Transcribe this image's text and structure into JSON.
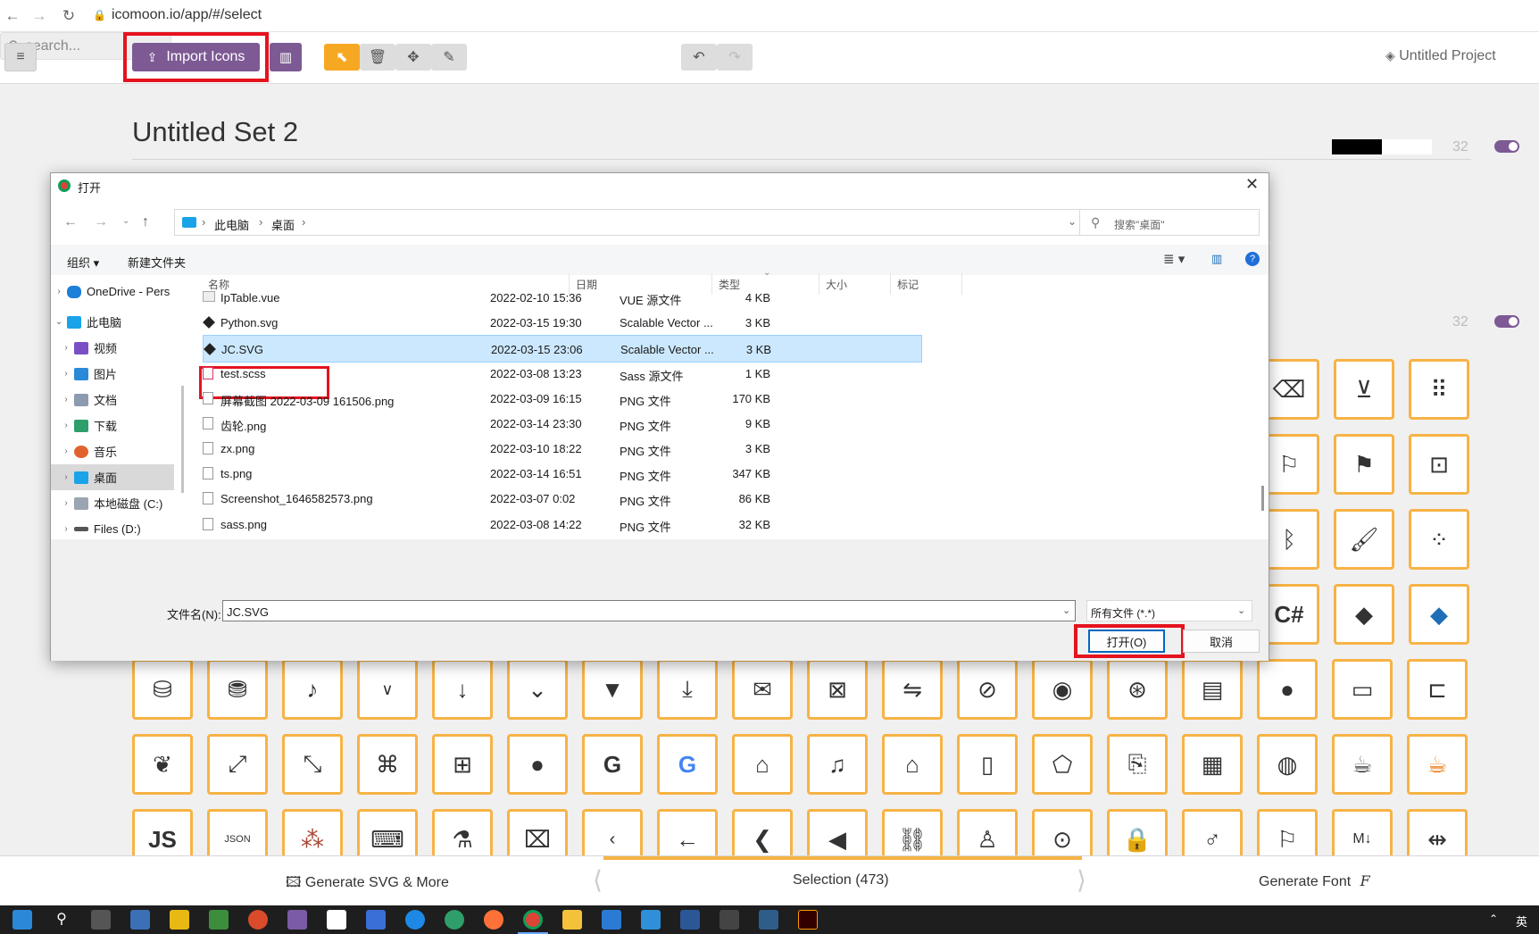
{
  "browser": {
    "url": "icomoon.io/app/#/select"
  },
  "toolbar": {
    "import_label": "Import Icons",
    "search_placeholder": "search...",
    "project": "Untitled Project",
    "colors": {
      "purple": "#7d5a94",
      "orange": "#f7a823",
      "red": "#e5131e"
    }
  },
  "set": {
    "title": "Untitled Set 2",
    "size_a": "32",
    "size_b": "32"
  },
  "icons": {
    "right_rows": [
      [
        "delete-backspace-icon",
        "download-circle-icon",
        "drag-handle-icon"
      ],
      [
        "flag-outline-icon",
        "flag-filled-icon",
        "presentation-icon"
      ],
      [
        "bluetooth-icon",
        "brush-icon",
        "scatter-chart-icon"
      ],
      [
        "csharp-icon",
        "kotlin-icon",
        "dart-icon"
      ]
    ],
    "csharp_text": "C#",
    "row_a": [
      "database-icon",
      "database-filled-icon",
      "tiktok-icon",
      "chevron-down-thin-icon",
      "arrow-down-icon",
      "chevron-down-icon",
      "caret-down-icon",
      "download-icon",
      "mail-icon",
      "excel-icon",
      "swap-icon",
      "eye-off-icon",
      "eye-icon",
      "fingerprint-icon",
      "document-icon",
      "firefox-icon",
      "folder-icon",
      "folder-open-icon"
    ],
    "row_b": [
      "paw-icon",
      "fullscreen-icon",
      "exit-fullscreen-icon",
      "gamepad-icon",
      "gift-icon",
      "github-icon",
      "google-g-icon",
      "google-color-icon",
      "bank-icon",
      "bell-icon",
      "home-icon",
      "door-icon",
      "html5-icon",
      "file-import-icon",
      "article-icon",
      "globe-icon",
      "java-icon",
      "java-color-icon"
    ],
    "row_c": [
      "javascript-icon",
      "json-file-icon",
      "jitsi-icon",
      "keyboard-icon",
      "flask-icon",
      "translate-icon",
      "chevron-left-thin-icon",
      "arrow-left-icon",
      "chevron-left-icon",
      "caret-left-icon",
      "link-icon",
      "linux-icon",
      "location-icon",
      "lock-icon",
      "male-icon",
      "flag-thin-icon",
      "markdown-icon",
      "compress-horizontal-icon"
    ],
    "js_text": "JS",
    "json_text": "JSON"
  },
  "bottom": {
    "generate_svg": "Generate SVG & More",
    "selection": "Selection (473)",
    "generate_font": "Generate Font"
  },
  "dialog": {
    "title": "打开",
    "breadcrumb": [
      "此电脑",
      "桌面"
    ],
    "search_placeholder": "搜索\"桌面\"",
    "organize": "组织",
    "new_folder": "新建文件夹",
    "tree": [
      {
        "label": "OneDrive - Pers",
        "icon": "onedrive-icon"
      },
      {
        "label": "此电脑",
        "icon": "computer-icon"
      },
      {
        "label": "视频",
        "icon": "video-folder-icon"
      },
      {
        "label": "图片",
        "icon": "pictures-folder-icon"
      },
      {
        "label": "文档",
        "icon": "documents-folder-icon"
      },
      {
        "label": "下载",
        "icon": "downloads-folder-icon"
      },
      {
        "label": "音乐",
        "icon": "music-folder-icon"
      },
      {
        "label": "桌面",
        "icon": "desktop-folder-icon"
      },
      {
        "label": "本地磁盘 (C:)",
        "icon": "drive-icon"
      },
      {
        "label": "Files (D:)",
        "icon": "drive-icon"
      }
    ],
    "columns": {
      "name": "名称",
      "date": "日期",
      "type": "类型",
      "size": "大小",
      "tags": "标记"
    },
    "files": [
      {
        "name": "IpTable.vue",
        "date": "2022-02-10 15:36",
        "type": "VUE 源文件",
        "size": "4 KB"
      },
      {
        "name": "Python.svg",
        "date": "2022-03-15 19:30",
        "type": "Scalable Vector ...",
        "size": "3 KB"
      },
      {
        "name": "JC.SVG",
        "date": "2022-03-15 23:06",
        "type": "Scalable Vector ...",
        "size": "3 KB"
      },
      {
        "name": "test.scss",
        "date": "2022-03-08 13:23",
        "type": "Sass 源文件",
        "size": "1 KB"
      },
      {
        "name": "屏幕截图 2022-03-09 161506.png",
        "date": "2022-03-09 16:15",
        "type": "PNG 文件",
        "size": "170 KB"
      },
      {
        "name": "齿轮.png",
        "date": "2022-03-14 23:30",
        "type": "PNG 文件",
        "size": "9 KB"
      },
      {
        "name": "zx.png",
        "date": "2022-03-10 18:22",
        "type": "PNG 文件",
        "size": "3 KB"
      },
      {
        "name": "ts.png",
        "date": "2022-03-14 16:51",
        "type": "PNG 文件",
        "size": "347 KB"
      },
      {
        "name": "Screenshot_1646582573.png",
        "date": "2022-03-07 0:02",
        "type": "PNG 文件",
        "size": "86 KB"
      },
      {
        "name": "sass.png",
        "date": "2022-03-08 14:22",
        "type": "PNG 文件",
        "size": "32 KB"
      }
    ],
    "selected_index": 2,
    "filename_label": "文件名(N):",
    "filename_value": "JC.SVG",
    "filetype_value": "所有文件 (*.*)",
    "open_label": "打开(O)",
    "cancel_label": "取消"
  },
  "taskbar": {
    "ime": "英"
  }
}
